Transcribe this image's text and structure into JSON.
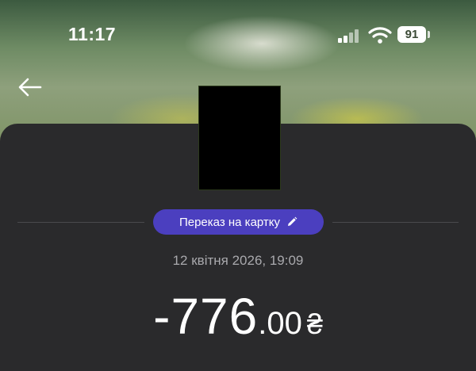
{
  "status_bar": {
    "time": "11:17",
    "battery": "91",
    "icons": [
      "cellular-signal-icon",
      "wifi-icon",
      "battery-icon"
    ]
  },
  "header": {
    "back_icon": "arrow-left-icon"
  },
  "transaction": {
    "category": "Переказ на картку",
    "category_icon": "pencil-icon",
    "datetime": "12 квітня 2026, 19:09",
    "amount_integer": "-776",
    "amount_fraction": ".00",
    "currency": "₴"
  },
  "colors": {
    "sheet_background": "#2a2a2c",
    "chip_accent": "#4b3fbf",
    "secondary_text": "#a9a9ad"
  }
}
